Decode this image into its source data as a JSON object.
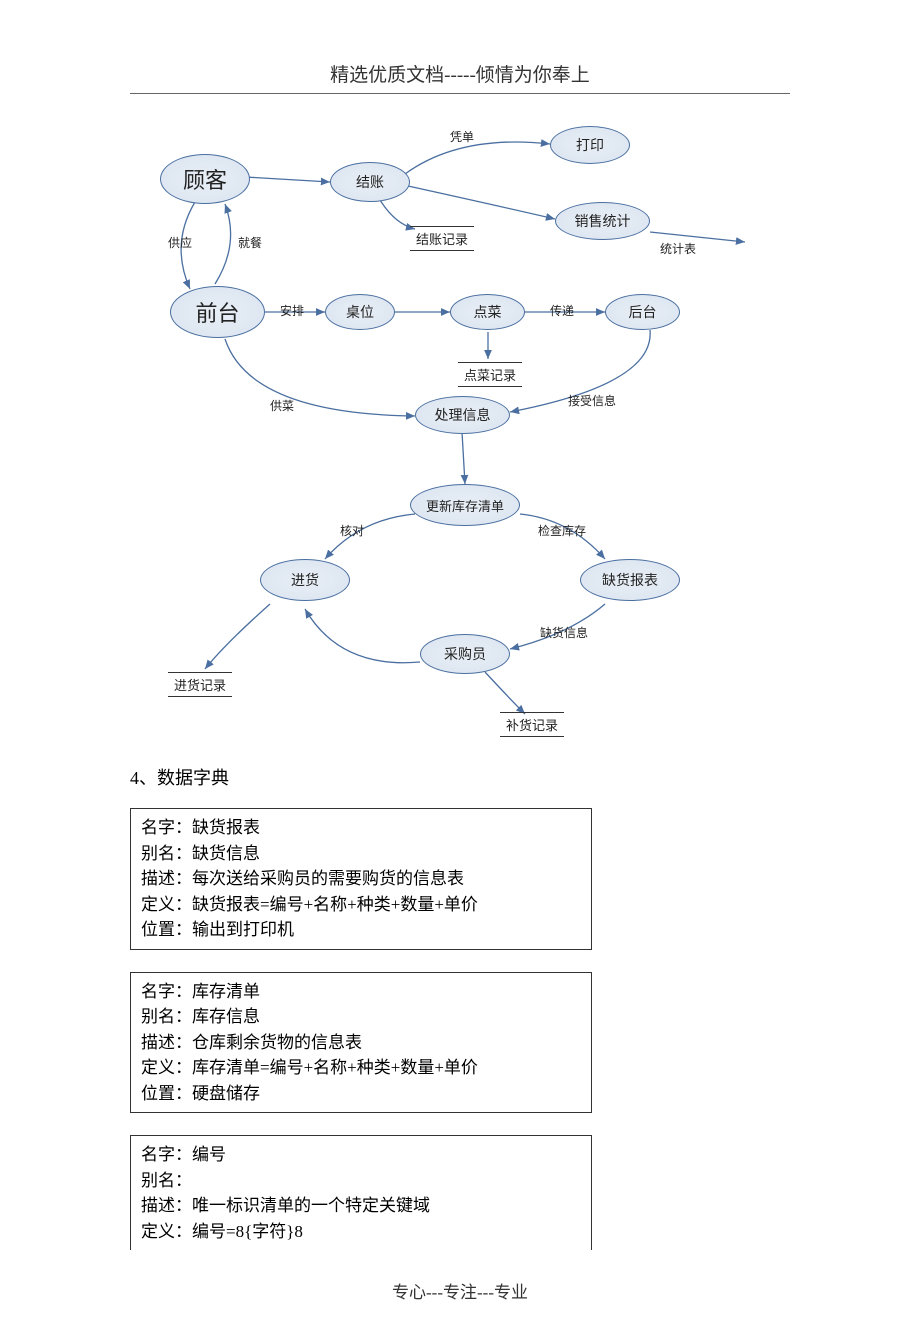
{
  "header": "精选优质文档-----倾情为你奉上",
  "footer": "专心---专注---专业",
  "section_title": "4、数据字典",
  "diagram": {
    "nodes": {
      "customer": "顾客",
      "frontdesk": "前台",
      "checkout": "结账",
      "print": "打印",
      "salesstat": "销售统计",
      "table": "桌位",
      "order": "点菜",
      "backend": "后台",
      "process": "处理信息",
      "updateinv": "更新库存清单",
      "stockin": "进货",
      "shortage": "缺货报表",
      "buyer": "采购员"
    },
    "stores": {
      "checkoutrec": "结账记录",
      "orderrec": "点菜记录",
      "stockinrec": "进货记录",
      "replenishrec": "补货记录"
    },
    "edges": {
      "voucher": "凭单",
      "supply": "供应",
      "dine": "就餐",
      "stattable": "统计表",
      "arrange": "安排",
      "pass": "传递",
      "servedish": "供菜",
      "recvinfo": "接受信息",
      "verify": "核对",
      "checkinv": "检查库存",
      "shortinfo": "缺货信息"
    }
  },
  "dict": [
    {
      "name": "名字：缺货报表",
      "alias": "别名：缺货信息",
      "desc": "描述：每次送给采购员的需要购货的信息表",
      "def": "定义：缺货报表=编号+名称+种类+数量+单价",
      "loc": "位置：输出到打印机"
    },
    {
      "name": "名字：库存清单",
      "alias": "别名：库存信息",
      "desc": "描述：仓库剩余货物的信息表",
      "def": "定义：库存清单=编号+名称+种类+数量+单价",
      "loc": "位置：硬盘储存"
    },
    {
      "name": "名字：编号",
      "alias": "别名：",
      "desc": "描述：唯一标识清单的一个特定关键域",
      "def": "定义：编号=8{字符}8",
      "loc": ""
    }
  ]
}
